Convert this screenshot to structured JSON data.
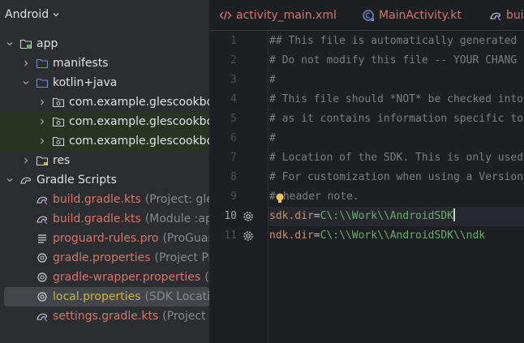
{
  "project_panel": {
    "title": "Android",
    "tree": [
      {
        "label": "app",
        "hint": "",
        "color": "default"
      },
      {
        "label": "manifests",
        "hint": "",
        "color": "default"
      },
      {
        "label": "kotlin+java",
        "hint": "",
        "color": "default"
      },
      {
        "label": "com.example.glescookbo",
        "hint": "",
        "color": "default"
      },
      {
        "label": "com.example.glescookbo",
        "hint": "",
        "color": "default"
      },
      {
        "label": "com.example.glescookbo",
        "hint": "",
        "color": "default"
      },
      {
        "label": "res",
        "hint": "",
        "color": "default"
      },
      {
        "label": "Gradle Scripts",
        "hint": "",
        "color": "default"
      },
      {
        "label": "build.gradle.kts",
        "hint": "(Project: gles",
        "color": "modified"
      },
      {
        "label": "build.gradle.kts",
        "hint": "(Module :app",
        "color": "modified"
      },
      {
        "label": "proguard-rules.pro",
        "hint": "(ProGuar",
        "color": "modified"
      },
      {
        "label": "gradle.properties",
        "hint": "(Project Pro",
        "color": "modified"
      },
      {
        "label": "gradle-wrapper.properties",
        "hint": "(G",
        "color": "modified"
      },
      {
        "label": "local.properties",
        "hint": "(SDK Locatio",
        "color": "new"
      },
      {
        "label": "settings.gradle.kts",
        "hint": "(Project Se",
        "color": "modified"
      }
    ]
  },
  "tabs": [
    {
      "label": "activity_main.xml",
      "icon": "xml-file-icon"
    },
    {
      "label": "MainActivity.kt",
      "icon": "kotlin-class-icon"
    },
    {
      "label": "bui",
      "icon": "gradle-kts-icon"
    }
  ],
  "editor": {
    "lines": [
      {
        "number": "1",
        "text": "## This file is automatically generated"
      },
      {
        "number": "2",
        "text": "# Do not modify this file -- YOUR CHANG"
      },
      {
        "number": "3",
        "text": "#"
      },
      {
        "number": "4",
        "text": "# This file should *NOT* be checked into"
      },
      {
        "number": "5",
        "text": "# as it contains information specific to"
      },
      {
        "number": "6",
        "text": "#"
      },
      {
        "number": "7",
        "text": "# Location of the SDK. This is only used"
      },
      {
        "number": "8",
        "text": "# For customization when using a Version"
      },
      {
        "number": "9",
        "text": "#",
        "text_after_bulb": "header note."
      },
      {
        "number": "10",
        "key": "sdk.dir",
        "op": "=",
        "value": "C\\:\\\\Work\\\\AndroidSDK"
      },
      {
        "number": "11",
        "key": "ndk.dir",
        "op": "=",
        "value": "C\\:\\\\Work\\\\AndroidSDK\\\\ndk"
      }
    ]
  },
  "colors": {
    "modified": "#d5756c",
    "new": "#c9b34f",
    "comment": "#7a7e85",
    "key": "#cf8e6d",
    "value": "#6aab73"
  }
}
